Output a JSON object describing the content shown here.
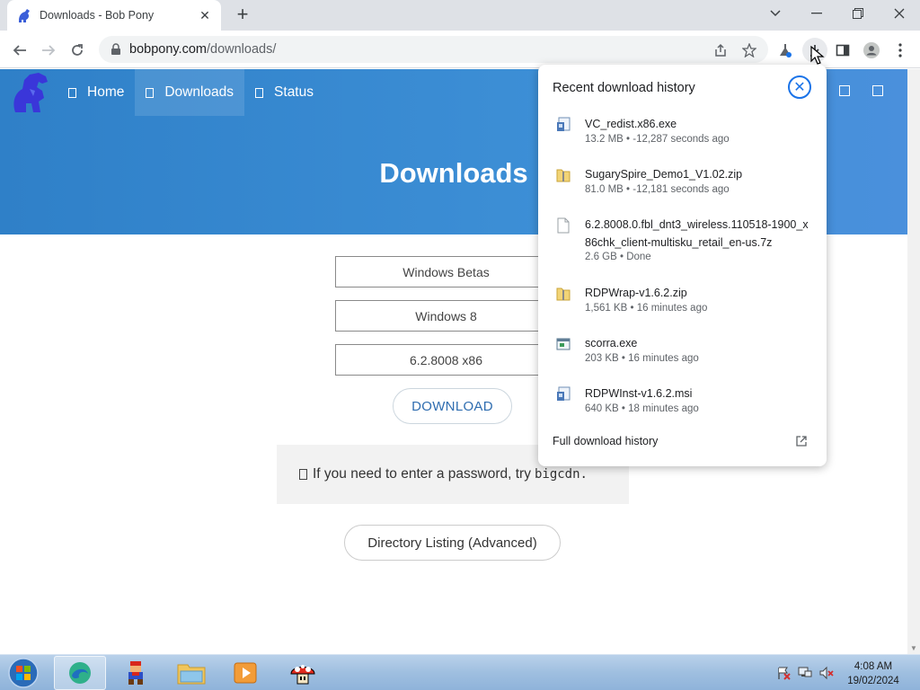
{
  "browser": {
    "tab_title": "Downloads - Bob Pony",
    "url_host": "bobpony.com",
    "url_path": "/downloads/"
  },
  "site": {
    "nav": [
      {
        "label": "Home"
      },
      {
        "label": "Downloads"
      },
      {
        "label": "Status"
      }
    ],
    "hero_title": "Downloads",
    "selects": [
      "Windows Betas",
      "Windows 8",
      "6.2.8008 x86"
    ],
    "download_button": "DOWNLOAD",
    "note_text": "If you need to enter a password, try",
    "note_code": "bigcdn.",
    "directory_button": "Directory Listing (Advanced)",
    "accent_color": "#3a8bd3"
  },
  "downloads_panel": {
    "title": "Recent download history",
    "items": [
      {
        "name": "VC_redist.x86.exe",
        "meta": "13.2 MB • -12,287 seconds ago",
        "icon": "installer-icon"
      },
      {
        "name": "SugarySpire_Demo1_V1.02.zip",
        "meta": "81.0 MB • -12,181 seconds ago",
        "icon": "zip-folder-icon"
      },
      {
        "name": "6.2.8008.0.fbl_dnt3_wireless.110518-1900_x86chk_client-multisku_retail_en-us.7z",
        "meta": "2.6 GB • Done",
        "icon": "blank-file-icon"
      },
      {
        "name": "RDPWrap-v1.6.2.zip",
        "meta": "1,561 KB • 16 minutes ago",
        "icon": "zip-folder-icon"
      },
      {
        "name": "scorra.exe",
        "meta": "203 KB • 16 minutes ago",
        "icon": "exe-window-icon"
      },
      {
        "name": "RDPWInst-v1.6.2.msi",
        "meta": "640 KB • 18 minutes ago",
        "icon": "installer-icon"
      }
    ],
    "full_history": "Full download history"
  },
  "taskbar": {
    "time": "4:08 AM",
    "date": "19/02/2024"
  }
}
